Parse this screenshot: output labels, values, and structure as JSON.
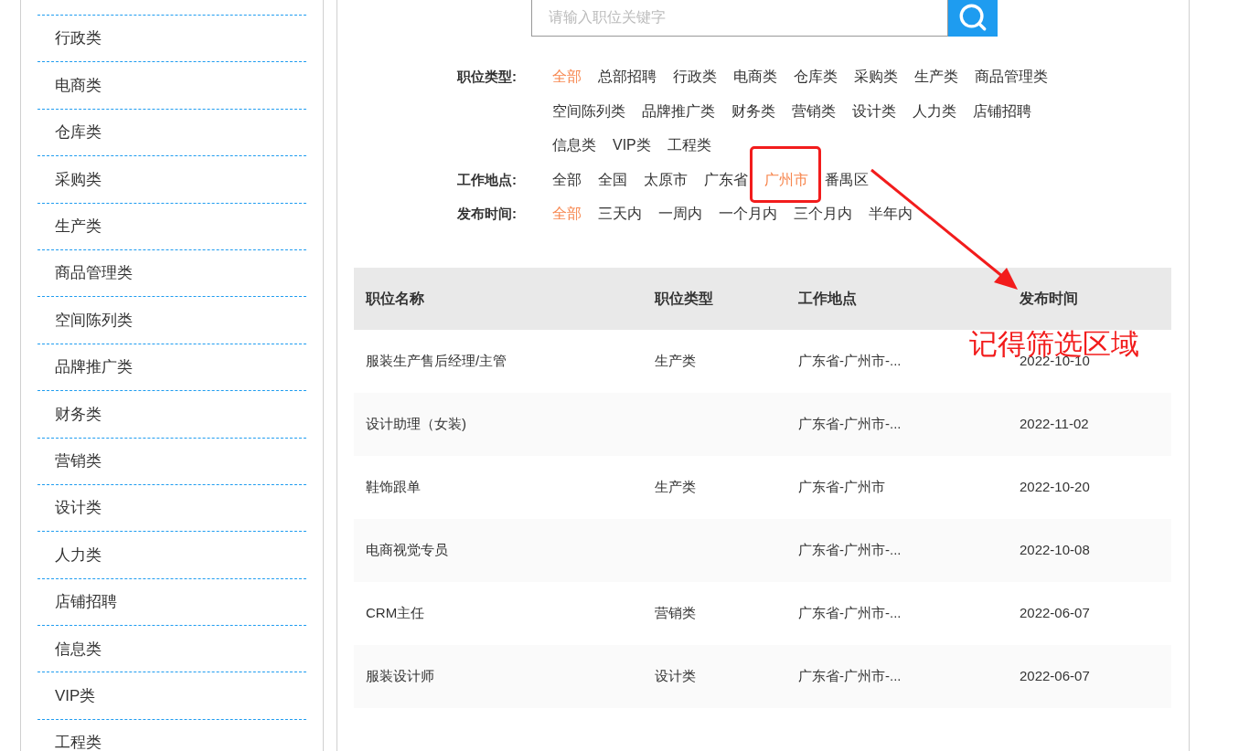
{
  "sidebar": {
    "items": [
      {
        "label": "行政类"
      },
      {
        "label": "电商类"
      },
      {
        "label": "仓库类"
      },
      {
        "label": "采购类"
      },
      {
        "label": "生产类"
      },
      {
        "label": "商品管理类"
      },
      {
        "label": "空间陈列类"
      },
      {
        "label": "品牌推广类"
      },
      {
        "label": "财务类"
      },
      {
        "label": "营销类"
      },
      {
        "label": "设计类"
      },
      {
        "label": "人力类"
      },
      {
        "label": "店铺招聘"
      },
      {
        "label": "信息类"
      },
      {
        "label": "VIP类"
      },
      {
        "label": "工程类"
      }
    ]
  },
  "search": {
    "placeholder": "请输入职位关键字"
  },
  "filters": [
    {
      "label": "职位类型:",
      "options": [
        {
          "label": "全部",
          "selected": true
        },
        {
          "label": "总部招聘",
          "selected": false
        },
        {
          "label": "行政类",
          "selected": false
        },
        {
          "label": "电商类",
          "selected": false
        },
        {
          "label": "仓库类",
          "selected": false
        },
        {
          "label": "采购类",
          "selected": false
        },
        {
          "label": "生产类",
          "selected": false
        },
        {
          "label": "商品管理类",
          "selected": false
        },
        {
          "label": "空间陈列类",
          "selected": false
        },
        {
          "label": "品牌推广类",
          "selected": false
        },
        {
          "label": "财务类",
          "selected": false
        },
        {
          "label": "营销类",
          "selected": false
        },
        {
          "label": "设计类",
          "selected": false
        },
        {
          "label": "人力类",
          "selected": false
        },
        {
          "label": "店铺招聘",
          "selected": false
        },
        {
          "label": "信息类",
          "selected": false
        },
        {
          "label": "VIP类",
          "selected": false
        },
        {
          "label": "工程类",
          "selected": false
        }
      ]
    },
    {
      "label": "工作地点:",
      "options": [
        {
          "label": "全部",
          "selected": false
        },
        {
          "label": "全国",
          "selected": false
        },
        {
          "label": "太原市",
          "selected": false
        },
        {
          "label": "广东省",
          "selected": false
        },
        {
          "label": "广州市",
          "selected": true
        },
        {
          "label": "番禺区",
          "selected": false
        }
      ]
    },
    {
      "label": "发布时间:",
      "options": [
        {
          "label": "全部",
          "selected": true
        },
        {
          "label": "三天内",
          "selected": false
        },
        {
          "label": "一周内",
          "selected": false
        },
        {
          "label": "一个月内",
          "selected": false
        },
        {
          "label": "三个月内",
          "selected": false
        },
        {
          "label": "半年内",
          "selected": false
        }
      ]
    }
  ],
  "table": {
    "columns": [
      "职位名称",
      "职位类型",
      "工作地点",
      "发布时间"
    ],
    "rows": [
      {
        "title": "服装生产售后经理/主管",
        "type": "生产类",
        "location": "广东省-广州市-...",
        "date": "2022-10-10"
      },
      {
        "title": "设计助理（女装)",
        "location": "广东省-广州市-...",
        "date": "2022-11-02"
      },
      {
        "title": "鞋饰跟单",
        "type": "生产类",
        "location": "广东省-广州市",
        "date": "2022-10-20"
      },
      {
        "title": "电商视觉专员",
        "location": "广东省-广州市-...",
        "date": "2022-10-08"
      },
      {
        "title": "CRM主任",
        "type": "营销类",
        "location": "广东省-广州市-...",
        "date": "2022-06-07"
      },
      {
        "title": "服装设计师",
        "type": "设计类",
        "location": "广东省-广州市-...",
        "date": "2022-06-07"
      }
    ]
  },
  "annotation": {
    "note": "记得筛选区域"
  }
}
